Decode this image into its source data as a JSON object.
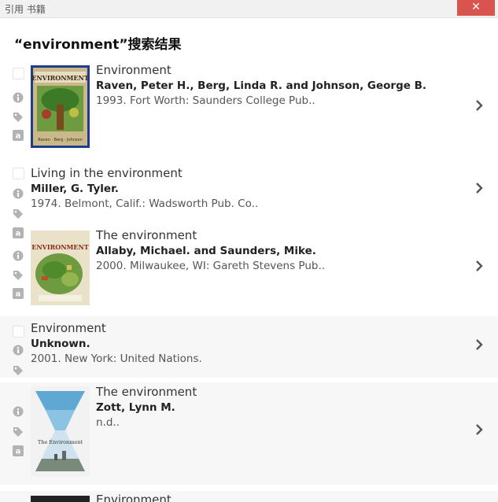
{
  "window": {
    "title": "引用 书籍",
    "close_glyph": "✕",
    "close_color": "#d9534f"
  },
  "heading": "“environment”搜索结果",
  "results": [
    {
      "title": "Environment",
      "authors": "Raven, Peter H., Berg, Linda R. and Johnson, George B.",
      "publication": "1993. Fort Worth: Saunders College Pub..",
      "cover_text": "ENVIRONMENT",
      "cover_subtext": "Raven · Berg · Johnson"
    },
    {
      "title": "Living in the environment",
      "authors": "Miller, G. Tyler.",
      "publication": "1974. Belmont, Calif.: Wadsworth Pub. Co.."
    },
    {
      "title": "The environment",
      "authors": "Allaby, Michael. and Saunders, Mike.",
      "publication": "2000. Milwaukee, WI: Gareth Stevens Pub..",
      "cover_text": "ENVIRONMENT"
    },
    {
      "title": "Environment",
      "authors": "Unknown.",
      "publication": "2001. New York: United Nations."
    },
    {
      "title": "The environment",
      "authors": "Zott, Lynn M.",
      "publication": "n.d..",
      "cover_text": "The Environment"
    },
    {
      "title": "Environment"
    }
  ]
}
